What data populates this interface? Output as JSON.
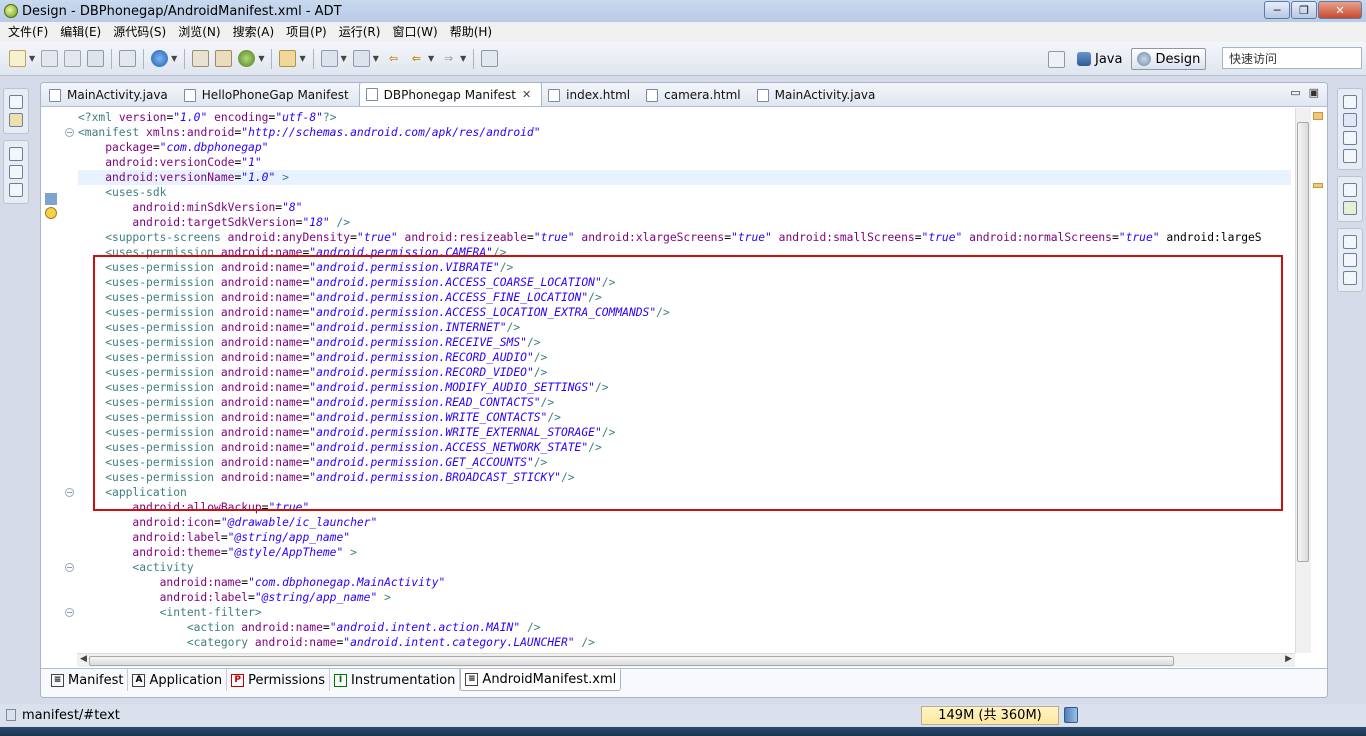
{
  "window": {
    "title": "Design  -  DBPhonegap/AndroidManifest.xml  -  ADT",
    "controls": [
      "─",
      "❐",
      "✕"
    ]
  },
  "menu": [
    "文件(F)",
    "编辑(E)",
    "源代码(S)",
    "浏览(N)",
    "搜索(A)",
    "项目(P)",
    "运行(R)",
    "窗口(W)",
    "帮助(H)"
  ],
  "perspectives": {
    "java": "Java",
    "design": "Design",
    "quick_access_placeholder": "快速访问"
  },
  "editor_tabs": [
    {
      "label": "MainActivity.java",
      "active": false
    },
    {
      "label": "HelloPhoneGap Manifest",
      "active": false
    },
    {
      "label": "DBPhonegap Manifest",
      "active": true
    },
    {
      "label": "index.html",
      "active": false
    },
    {
      "label": "camera.html",
      "active": false
    },
    {
      "label": "MainActivity.java",
      "active": false
    }
  ],
  "code": {
    "pi": "<?xml version=\"1.0\" encoding=\"utf-8\"?>",
    "manifest_open": "<manifest xmlns:android=\"http://schemas.android.com/apk/res/android\"",
    "package": "    package=\"com.dbphonegap\"",
    "versionCode": "    android:versionCode=\"1\"",
    "versionName": "    android:versionName=\"1.0\" >",
    "uses_sdk": "    <uses-sdk",
    "minSdk": "        android:minSdkVersion=\"8\"",
    "targetSdk": "        android:targetSdkVersion=\"18\" />",
    "supports_screens": "    <supports-screens android:anyDensity=\"true\" android:resizeable=\"true\" android:xlargeScreens=\"true\" android:smallScreens=\"true\" android:normalScreens=\"true\" android:largeS",
    "permissions": [
      "android.permission.CAMERA",
      "android.permission.VIBRATE",
      "android.permission.ACCESS_COARSE_LOCATION",
      "android.permission.ACCESS_FINE_LOCATION",
      "android.permission.ACCESS_LOCATION_EXTRA_COMMANDS",
      "android.permission.INTERNET",
      "android.permission.RECEIVE_SMS",
      "android.permission.RECORD_AUDIO",
      "android.permission.RECORD_VIDEO",
      "android.permission.MODIFY_AUDIO_SETTINGS",
      "android.permission.READ_CONTACTS",
      "android.permission.WRITE_CONTACTS",
      "android.permission.WRITE_EXTERNAL_STORAGE",
      "android.permission.ACCESS_NETWORK_STATE",
      "android.permission.GET_ACCOUNTS",
      "android.permission.BROADCAST_STICKY"
    ],
    "application": "    <application",
    "allowBackup": "        android:allowBackup=\"true\"",
    "icon": "        android:icon=\"@drawable/ic_launcher\"",
    "label": "        android:label=\"@string/app_name\"",
    "theme": "        android:theme=\"@style/AppTheme\" >",
    "activity": "        <activity",
    "activity_name": "            android:name=\"com.dbphonegap.MainActivity\"",
    "activity_label": "            android:label=\"@string/app_name\" >",
    "intent_filter": "            <intent-filter>",
    "action": "                <action android:name=\"android.intent.action.MAIN\" />",
    "category": "                <category android:name=\"android.intent.category.LAUNCHER\" />"
  },
  "page_tabs": [
    {
      "label": "Manifest",
      "icon": "≡",
      "active": false
    },
    {
      "label": "Application",
      "icon": "A",
      "active": false
    },
    {
      "label": "Permissions",
      "icon": "P",
      "active": false
    },
    {
      "label": "Instrumentation",
      "icon": "I",
      "active": false
    },
    {
      "label": "AndroidManifest.xml",
      "icon": "≡",
      "active": true
    }
  ],
  "status": {
    "path": "manifest/#text",
    "heap": "149M (共 360M)"
  }
}
